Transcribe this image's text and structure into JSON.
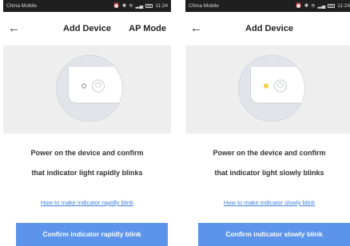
{
  "screens": [
    {
      "status": {
        "carrier": "China Mobile",
        "icons": "⏰ ✱ ⭘ ὏6",
        "time": "11:24"
      },
      "nav": {
        "back_icon": "←",
        "title": "Add Device",
        "action": "AP Mode"
      },
      "led_state": "off",
      "instruction_line1": "Power on the device and confirm",
      "instruction_line2": "that indicator light rapidly blinks",
      "help_link": "How to make indicator rapidly blink",
      "confirm_button": "Confirm indicator rapidly blink"
    },
    {
      "status": {
        "carrier": "China Mobile",
        "icons": "⏰ ✱ ⭘ ὏6",
        "time": "11:24"
      },
      "nav": {
        "back_icon": "←",
        "title": "Add Device",
        "action": ""
      },
      "led_state": "on",
      "instruction_line1": "Power on the device and confirm",
      "instruction_line2": "that indicator light slowly blinks",
      "help_link": "How to make indicator slowly blink",
      "confirm_button": "Confirm indicator slowly blink"
    }
  ],
  "colors": {
    "accent": "#5b94ea",
    "link": "#3d7fe0",
    "led_on": "#f3d23a"
  }
}
